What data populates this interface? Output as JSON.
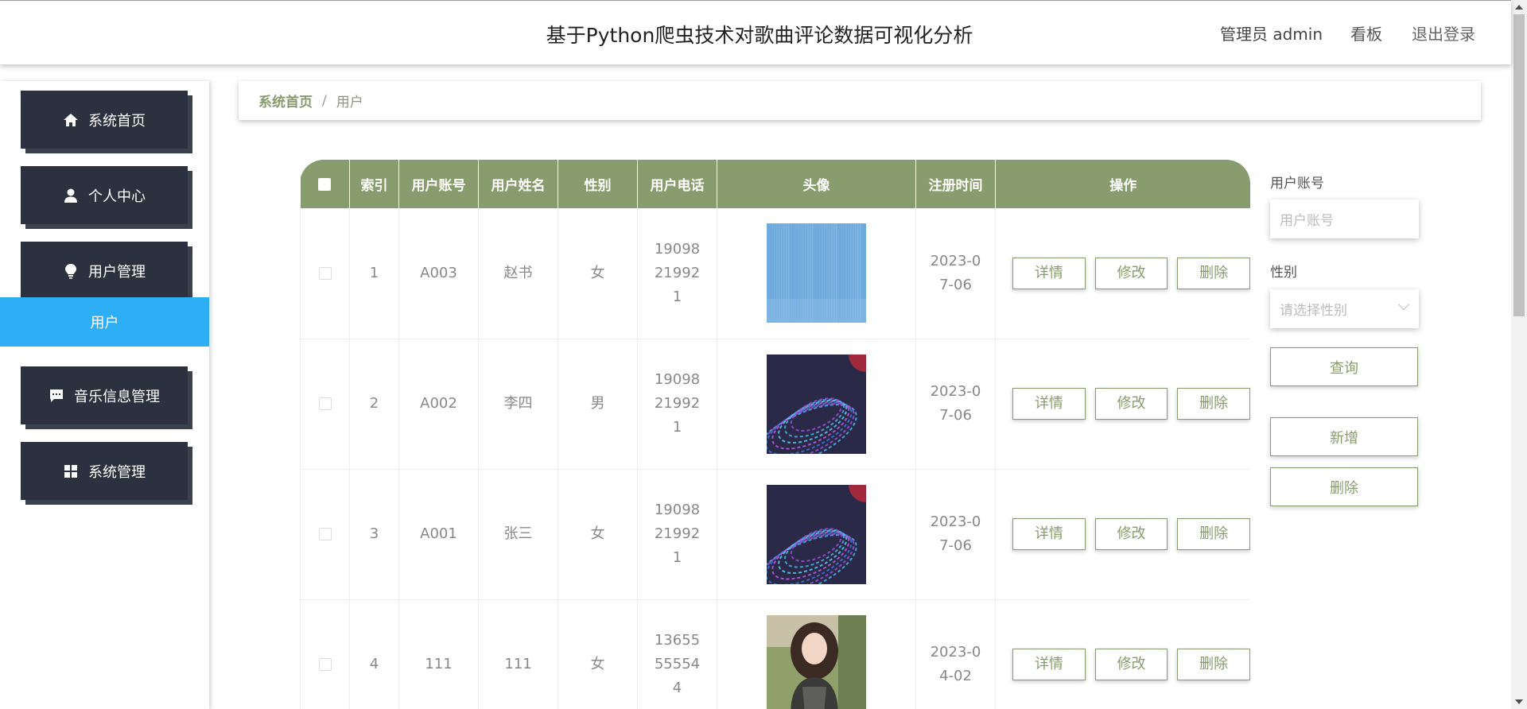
{
  "header": {
    "title": "基于Python爬虫技术对歌曲评论数据可视化分析",
    "admin": "管理员 admin",
    "board": "看板",
    "logout": "退出登录"
  },
  "sidebar": {
    "items": [
      {
        "label": "系统首页",
        "icon": "home-icon"
      },
      {
        "label": "个人中心",
        "icon": "person-icon"
      },
      {
        "label": "用户管理",
        "icon": "bulb-icon"
      },
      {
        "label": "音乐信息管理",
        "icon": "message-icon"
      },
      {
        "label": "系统管理",
        "icon": "grid-icon"
      }
    ],
    "active_submenu": "用户"
  },
  "breadcrumb": {
    "home": "系统首页",
    "separator": "/",
    "current": "用户"
  },
  "table": {
    "columns": [
      "索引",
      "用户账号",
      "用户姓名",
      "性别",
      "用户电话",
      "头像",
      "注册时间",
      "操作"
    ],
    "rows": [
      {
        "index": "1",
        "account": "A003",
        "name": "赵书",
        "gender": "女",
        "phone": "19098219921",
        "avatar": "blue-stripes",
        "date": "2023-07-06"
      },
      {
        "index": "2",
        "account": "A002",
        "name": "李四",
        "gender": "男",
        "phone": "19098219921",
        "avatar": "dark-swirl",
        "date": "2023-07-06"
      },
      {
        "index": "3",
        "account": "A001",
        "name": "张三",
        "gender": "女",
        "phone": "19098219921",
        "avatar": "dark-swirl",
        "date": "2023-07-06"
      },
      {
        "index": "4",
        "account": "111",
        "name": "111",
        "gender": "女",
        "phone": "13655555544",
        "avatar": "portrait-photo",
        "date": "2023-04-02"
      }
    ],
    "actions": {
      "detail": "详情",
      "edit": "修改",
      "delete": "删除"
    }
  },
  "search": {
    "account_label": "用户账号",
    "account_placeholder": "用户账号",
    "gender_label": "性别",
    "gender_placeholder": "请选择性别",
    "query": "查询",
    "add": "新增",
    "delete": "删除"
  },
  "colors": {
    "accent": "#889c6d",
    "sidebar_button": "#2b313e",
    "active_submenu": "#2eaef4"
  }
}
